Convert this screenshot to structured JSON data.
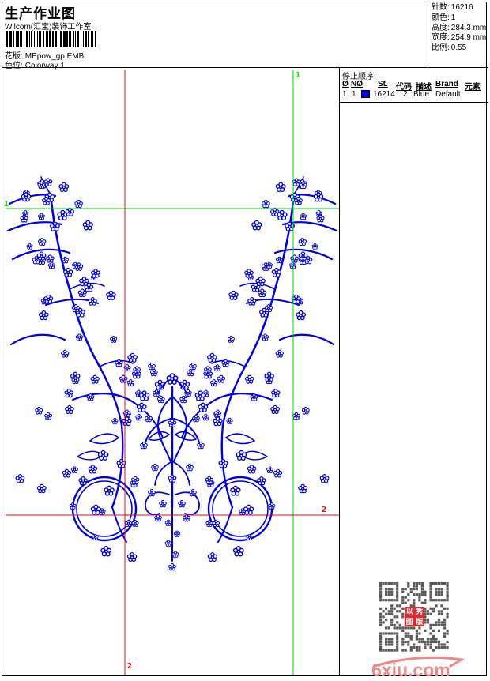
{
  "header": {
    "title": "生产作业图",
    "studio": "Wilcom(汇宝)装饰工作室",
    "pattern_label": "花版:",
    "pattern_value": "MEpow_gp.EMB",
    "colorway_label": "色位:",
    "colorway_value": "Colorway 1",
    "stats": [
      {
        "label": "针数:",
        "value": "16216"
      },
      {
        "label": "颜色:",
        "value": "1"
      },
      {
        "label": "高度:",
        "value": "284.3 mm"
      },
      {
        "label": "宽度:",
        "value": "254.9 mm"
      },
      {
        "label": "比例:",
        "value": "0.55"
      }
    ]
  },
  "stop_sequence": {
    "title": "停止顺序:",
    "columns": [
      "Ø",
      "NØ",
      "St.",
      "代码",
      "描述",
      "Brand",
      "元素"
    ],
    "row": {
      "index": "1.",
      "n": "1",
      "swatch_color": "#0000e0",
      "st": "16214",
      "code": "2",
      "desc": "Blue",
      "brand": "Default",
      "elements": ""
    }
  },
  "guides": {
    "label_start": "1",
    "label_end": "2",
    "green_color": "#00d800",
    "red_color": "#ff0000"
  },
  "design": {
    "thread_color": "#0000e6"
  },
  "qr": {
    "module_color": "#5a5a5a",
    "seal_color": "#d53030",
    "seal_chars": [
      "以",
      "秀",
      "图",
      "版"
    ]
  },
  "watermark": {
    "text": "6xiu.com",
    "color": "#ef8888"
  }
}
